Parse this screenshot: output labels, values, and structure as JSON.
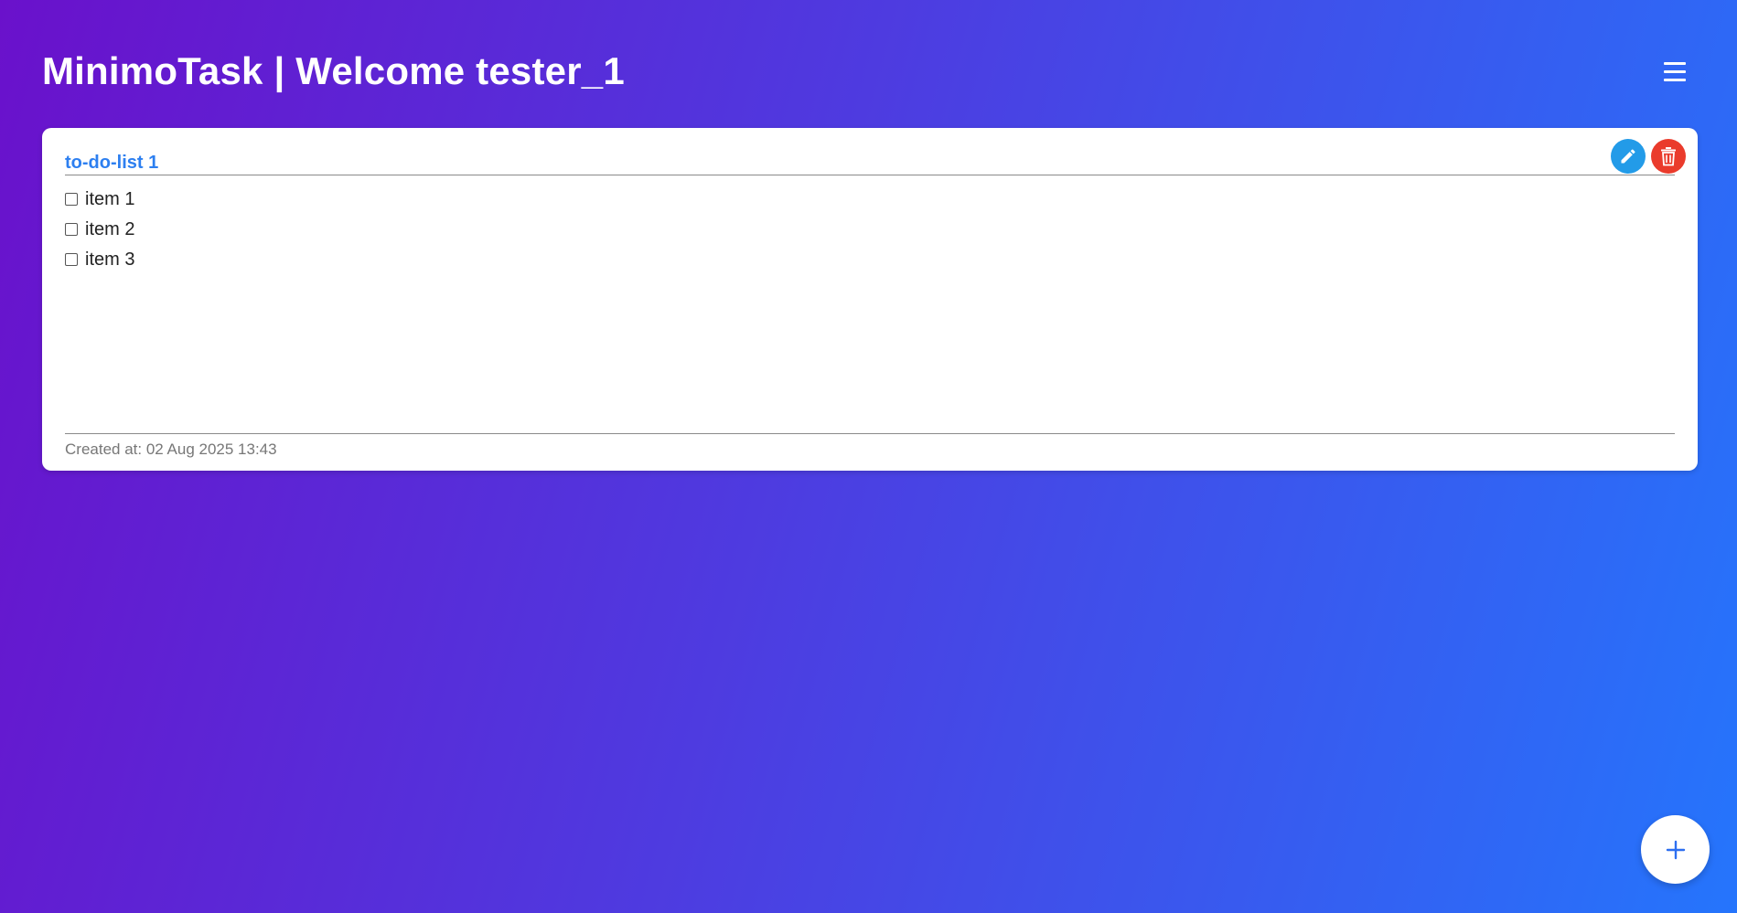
{
  "header": {
    "title": "MinimoTask | Welcome tester_1",
    "menu_icon": "hamburger-menu-icon"
  },
  "todo_list": {
    "title": "to-do-list 1",
    "items": [
      {
        "label": "item 1",
        "checked": false
      },
      {
        "label": "item 2",
        "checked": false
      },
      {
        "label": "item 3",
        "checked": false
      }
    ],
    "created_at": "Created at: 02 Aug 2025 13:43",
    "edit_icon": "pencil-icon",
    "delete_icon": "trash-icon"
  },
  "fab": {
    "icon": "plus-icon"
  },
  "colors": {
    "gradient_start": "#6a11cb",
    "gradient_end": "#2575fc",
    "title_blue": "#2d7ff0",
    "edit_blue": "#239be8",
    "delete_red": "#ea3b2c"
  }
}
